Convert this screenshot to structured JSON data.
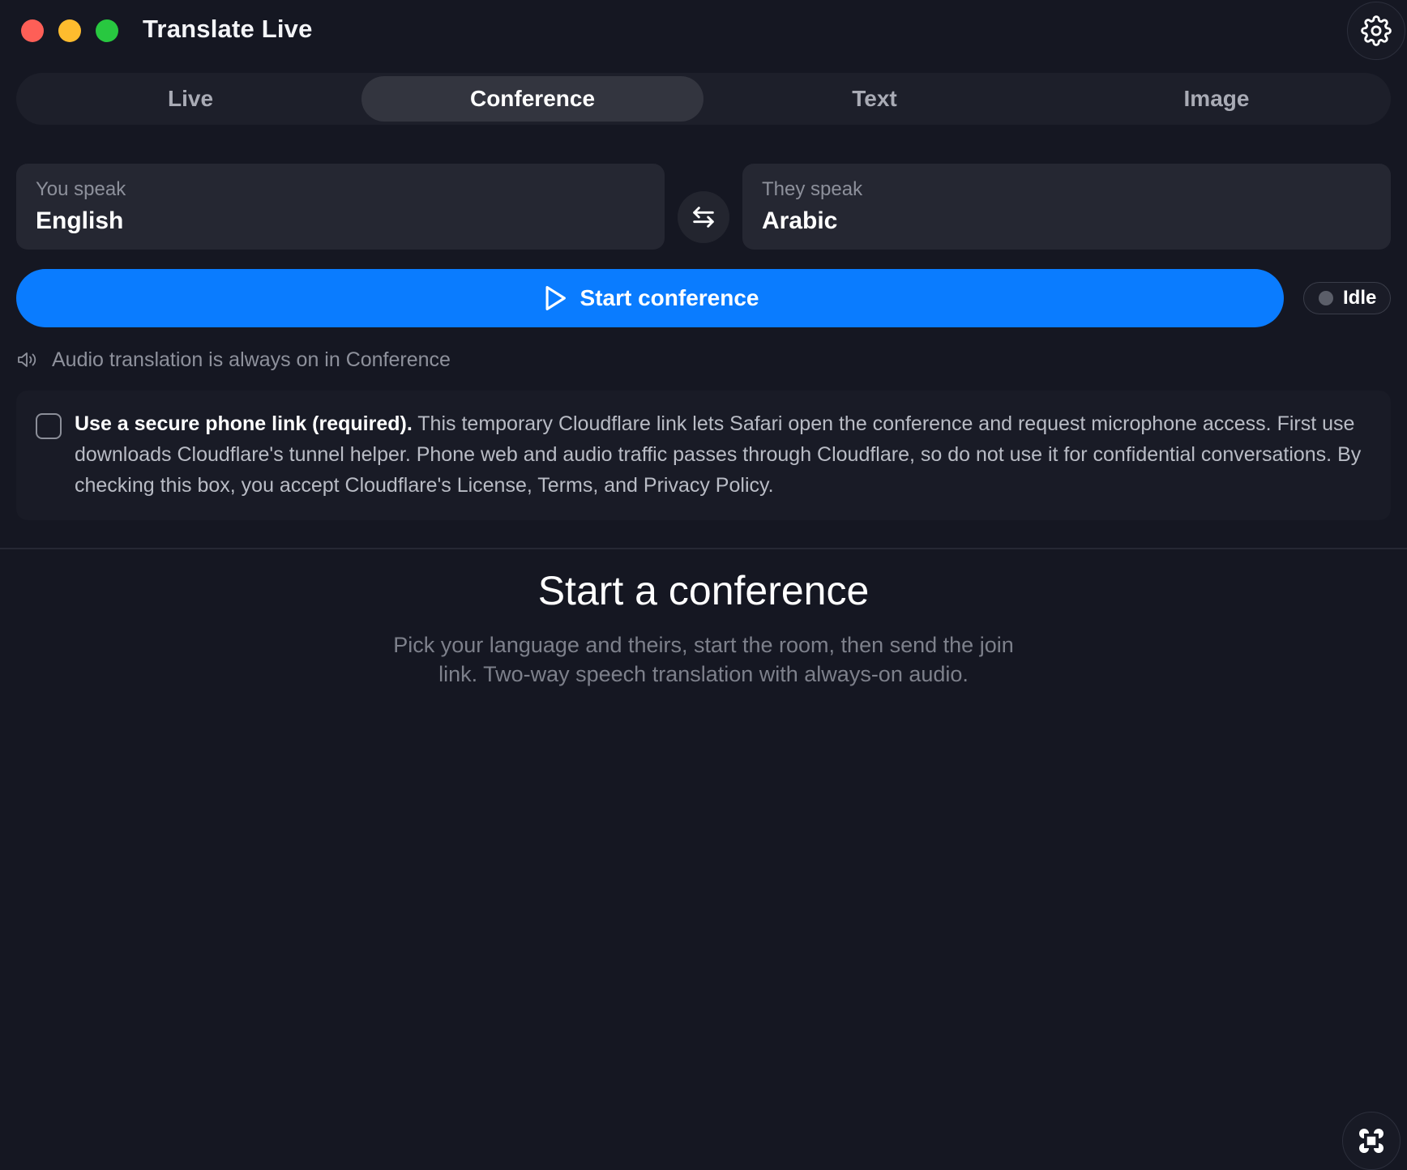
{
  "window": {
    "title": "Translate Live",
    "traffic_lights": [
      "close",
      "minimize",
      "zoom"
    ]
  },
  "header": {
    "settings_icon": "gear-icon"
  },
  "tabs": [
    {
      "label": "Live",
      "active": false
    },
    {
      "label": "Conference",
      "active": true
    },
    {
      "label": "Text",
      "active": false
    },
    {
      "label": "Image",
      "active": false
    }
  ],
  "languages": {
    "source": {
      "caption": "You speak",
      "value": "English"
    },
    "target": {
      "caption": "They speak",
      "value": "Arabic"
    },
    "swap_icon": "swap-arrows-icon"
  },
  "start": {
    "label": "Start conference",
    "icon": "play-icon",
    "color": "#0a7cff"
  },
  "status": {
    "label": "Idle"
  },
  "audio_note": {
    "icon": "speaker-icon",
    "text": "Audio translation is always on in Conference"
  },
  "consent": {
    "checked": false,
    "strong": "Use a secure phone link (required).",
    "body": " This temporary Cloudflare link lets Safari open the conference and request microphone access. First use downloads Cloudflare's tunnel helper. Phone web and audio traffic passes through Cloudflare, so do not use it for confidential conversations. By checking this box, you accept Cloudflare's License, Terms, and Privacy Policy."
  },
  "empty_state": {
    "title": "Start a conference",
    "description": "Pick your language and theirs, start the room, then send the join link. Two-way speech translation with always-on audio."
  },
  "corner_button": {
    "icon": "command-key-icon"
  }
}
